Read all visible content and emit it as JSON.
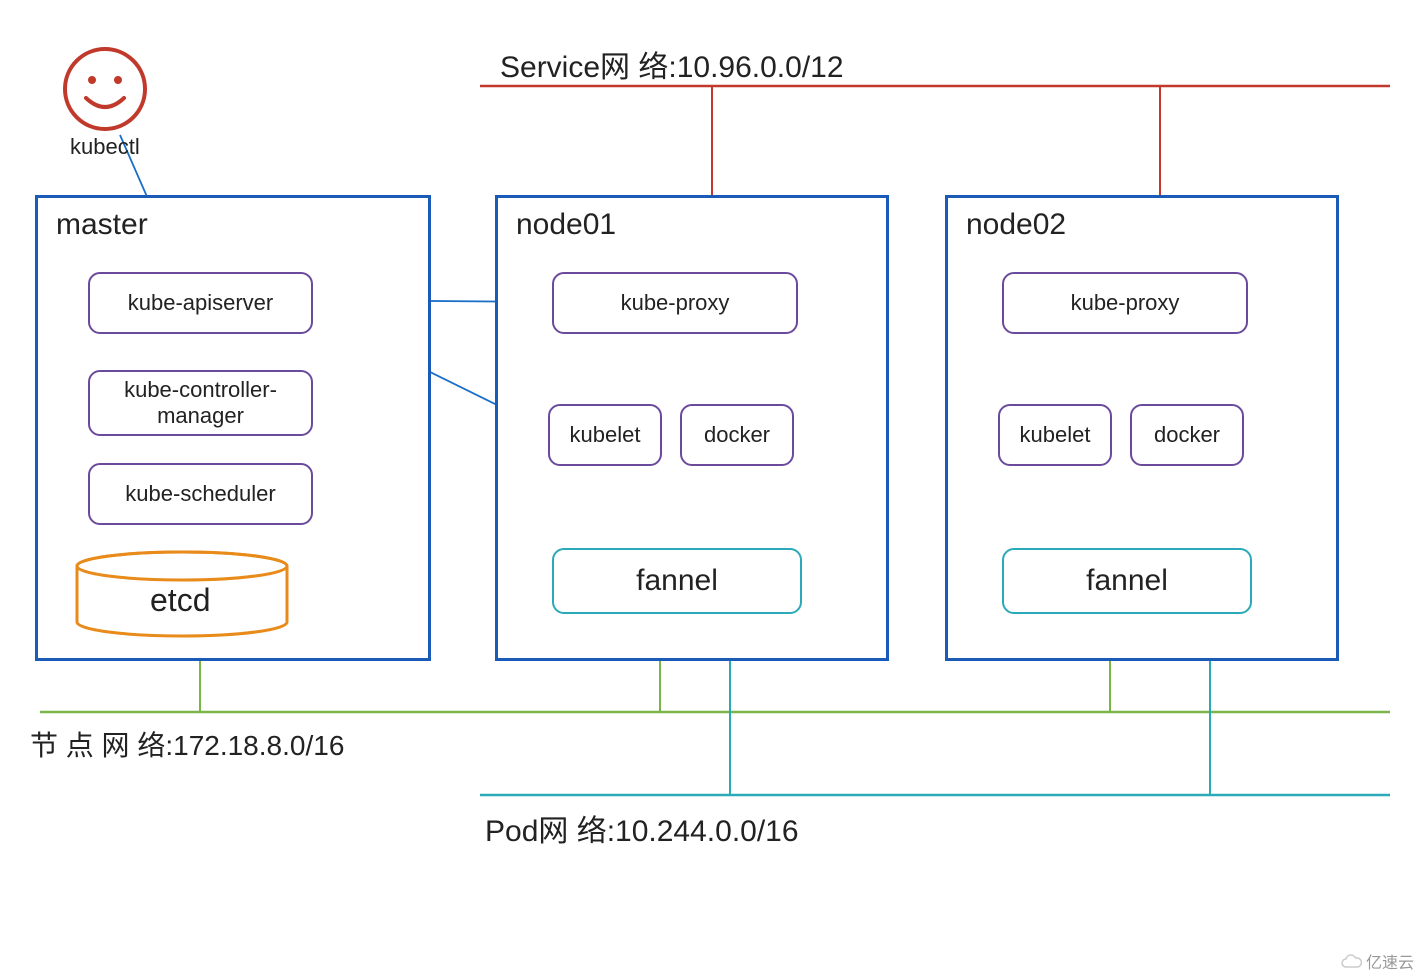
{
  "diagram": {
    "service_network_label": "Service网 络:10.96.0.0/12",
    "node_network_label": "节 点 网 络:172.18.8.0/16",
    "pod_network_label": "Pod网 络:10.244.0.0/16",
    "kubectl_label": "kubectl",
    "master": {
      "title": "master",
      "components": {
        "apiserver": "kube-apiserver",
        "controller_manager": "kube-controller-\nmanager",
        "scheduler": "kube-scheduler",
        "etcd": "etcd"
      }
    },
    "node01": {
      "title": "node01",
      "components": {
        "kube_proxy": "kube-proxy",
        "kubelet": "kubelet",
        "docker": "docker",
        "fannel": "fannel"
      }
    },
    "node02": {
      "title": "node02",
      "components": {
        "kube_proxy": "kube-proxy",
        "kubelet": "kubelet",
        "docker": "docker",
        "fannel": "fannel"
      }
    },
    "watermark": "亿速云",
    "colors": {
      "blue_border": "#1a5bb8",
      "purple_border": "#6b4a9c",
      "teal": "#2aa9b8",
      "orange": "#e88b1a",
      "red": "#c1392b",
      "green": "#7ab548",
      "arrow_blue": "#1a6fc9"
    },
    "networks": {
      "service": "10.96.0.0/12",
      "node": "172.18.8.0/16",
      "pod": "10.244.0.0/16"
    }
  }
}
